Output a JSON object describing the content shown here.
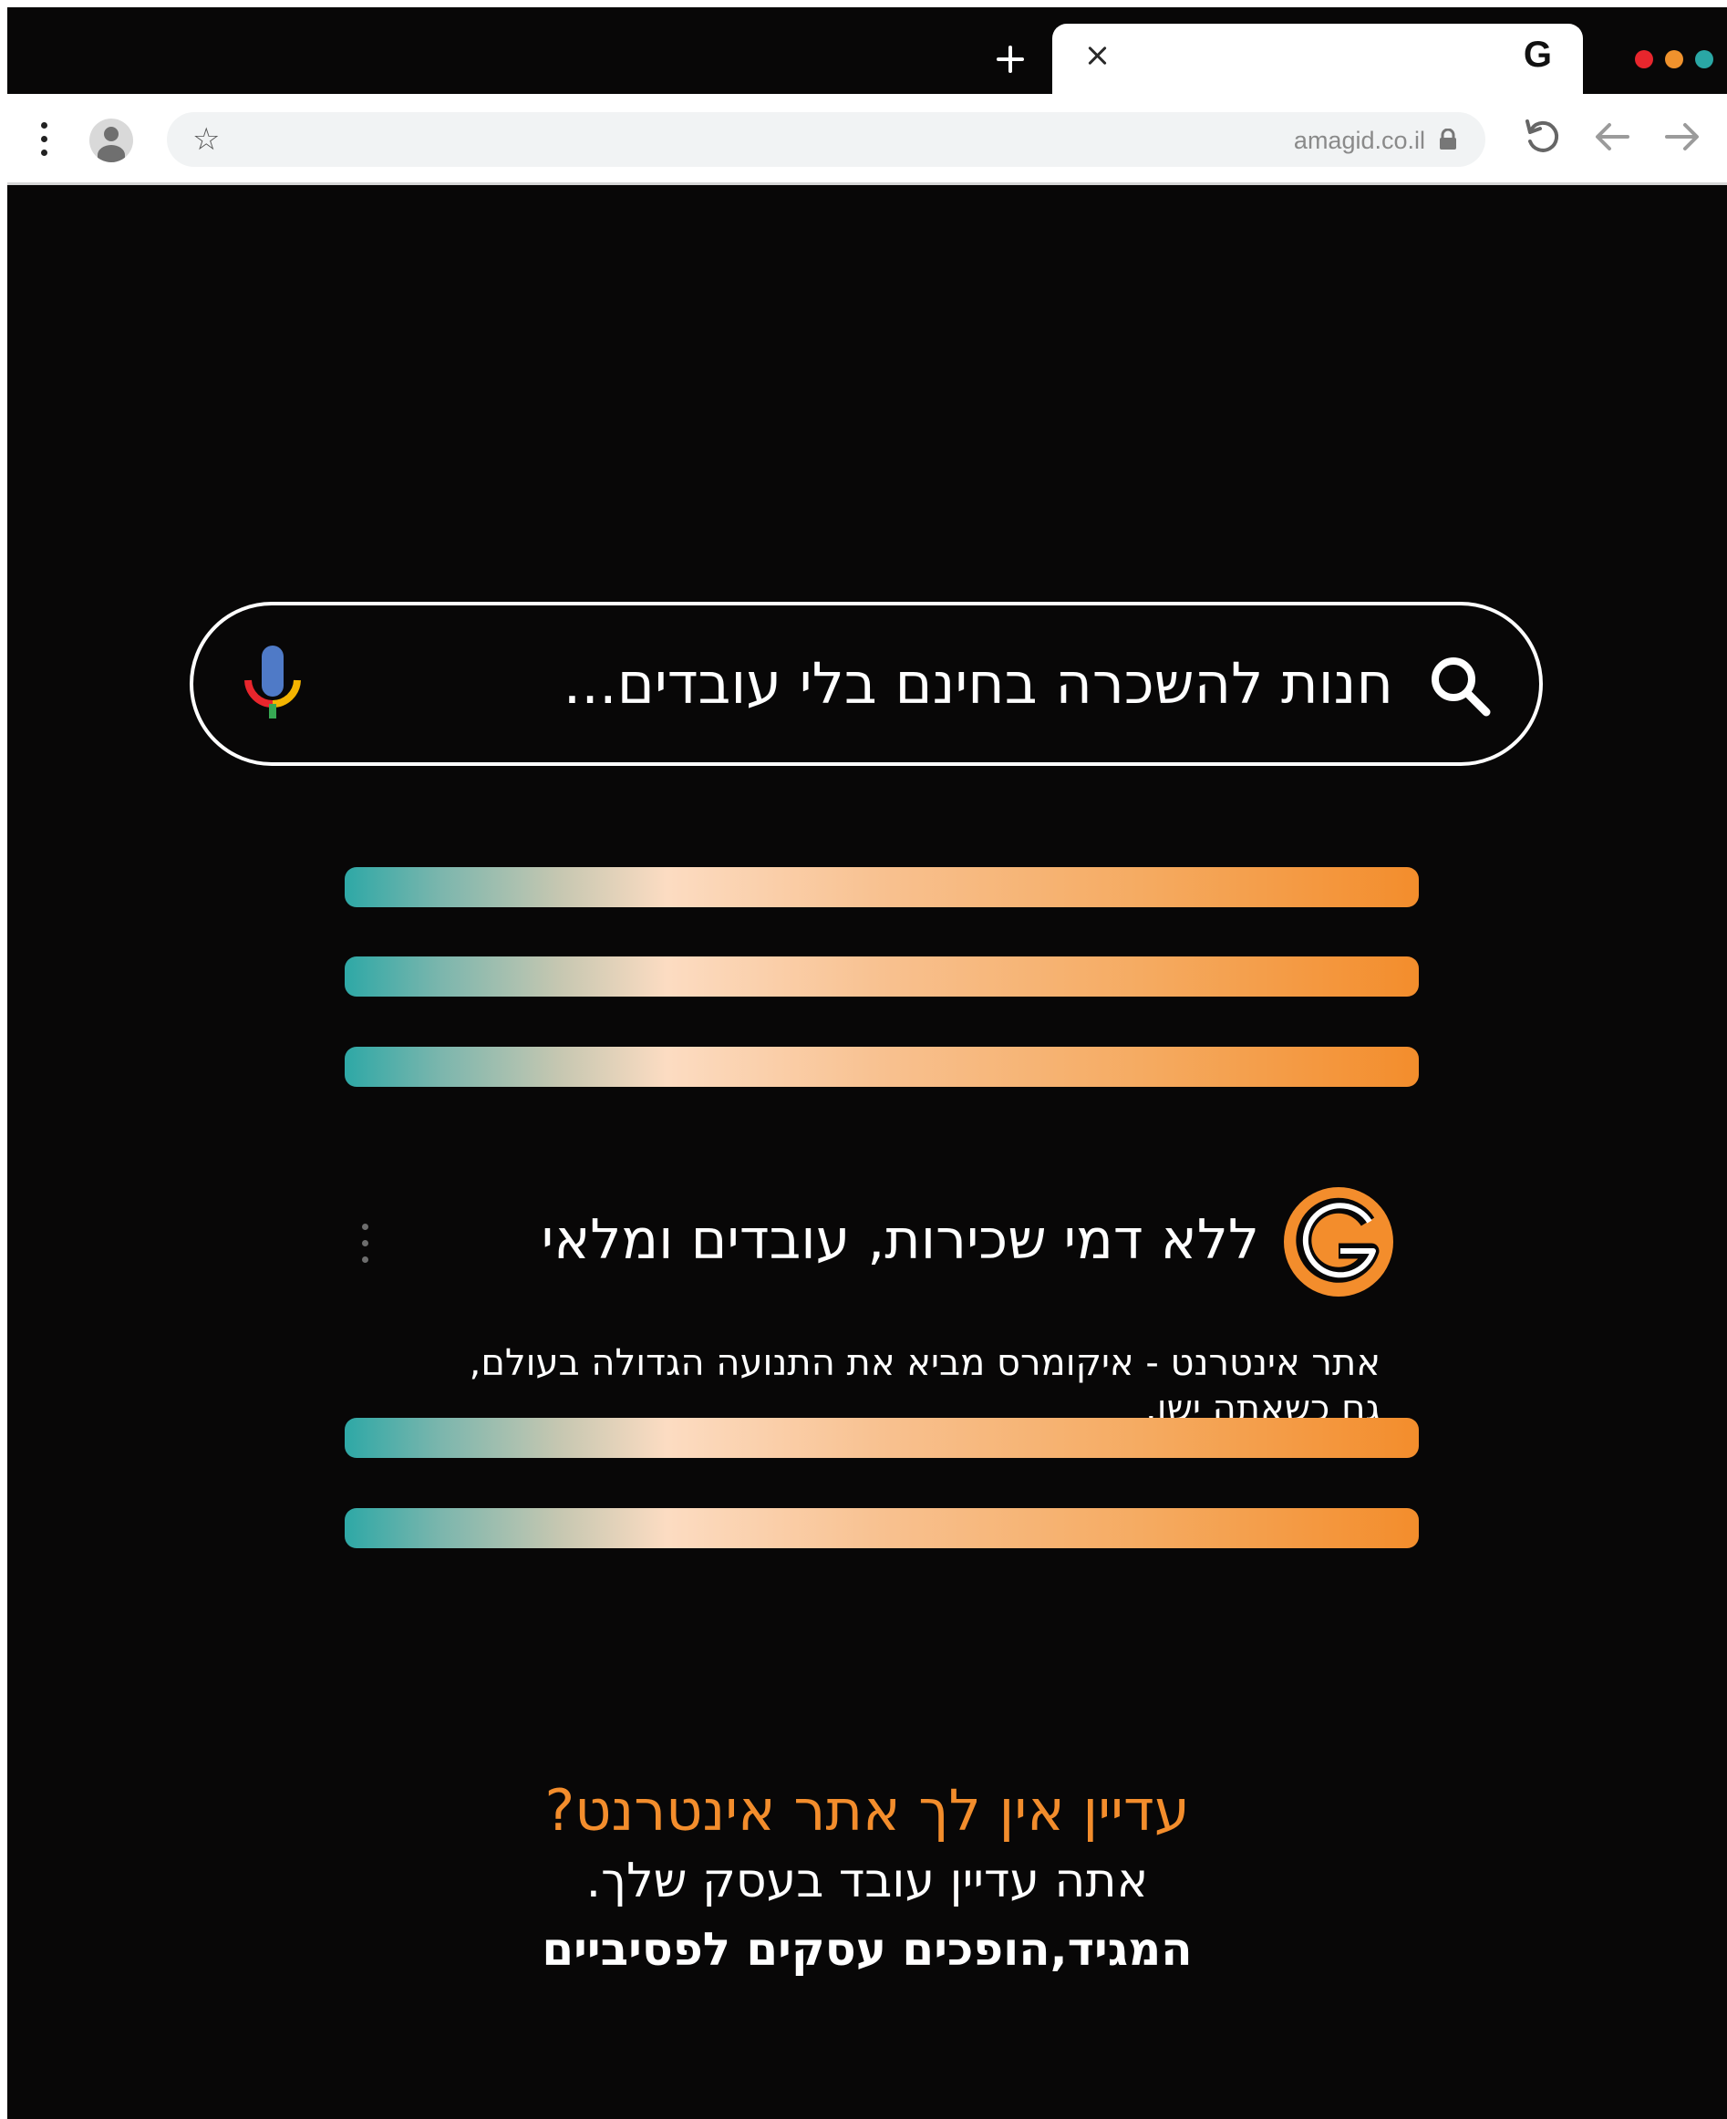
{
  "browser": {
    "url": "amagid.co.il",
    "tab_favicon_letter": "G",
    "traffic_lights": [
      "#e8262d",
      "#f0922d",
      "#2aa7a5"
    ]
  },
  "search": {
    "query": "חנות להשכרה בחינם בלי עובדים..."
  },
  "result": {
    "logo_letter": "G",
    "title": "ללא דמי שכירות, עובדים ומלאי",
    "description": "אתר אינטרנט - איקומרס מביא את התנועה הגדולה בעולם, גם כשאתה ישן."
  },
  "cta": {
    "heading": "עדיין אין לך אתר אינטרנט?",
    "line": "אתה עדיין עובד בעסק שלך.",
    "tagline": "המגיד,הופכים עסקים לפסיביים"
  },
  "colors": {
    "background": "#080707",
    "accent_orange": "#f38d2c",
    "accent_teal": "#2ea8a6"
  }
}
